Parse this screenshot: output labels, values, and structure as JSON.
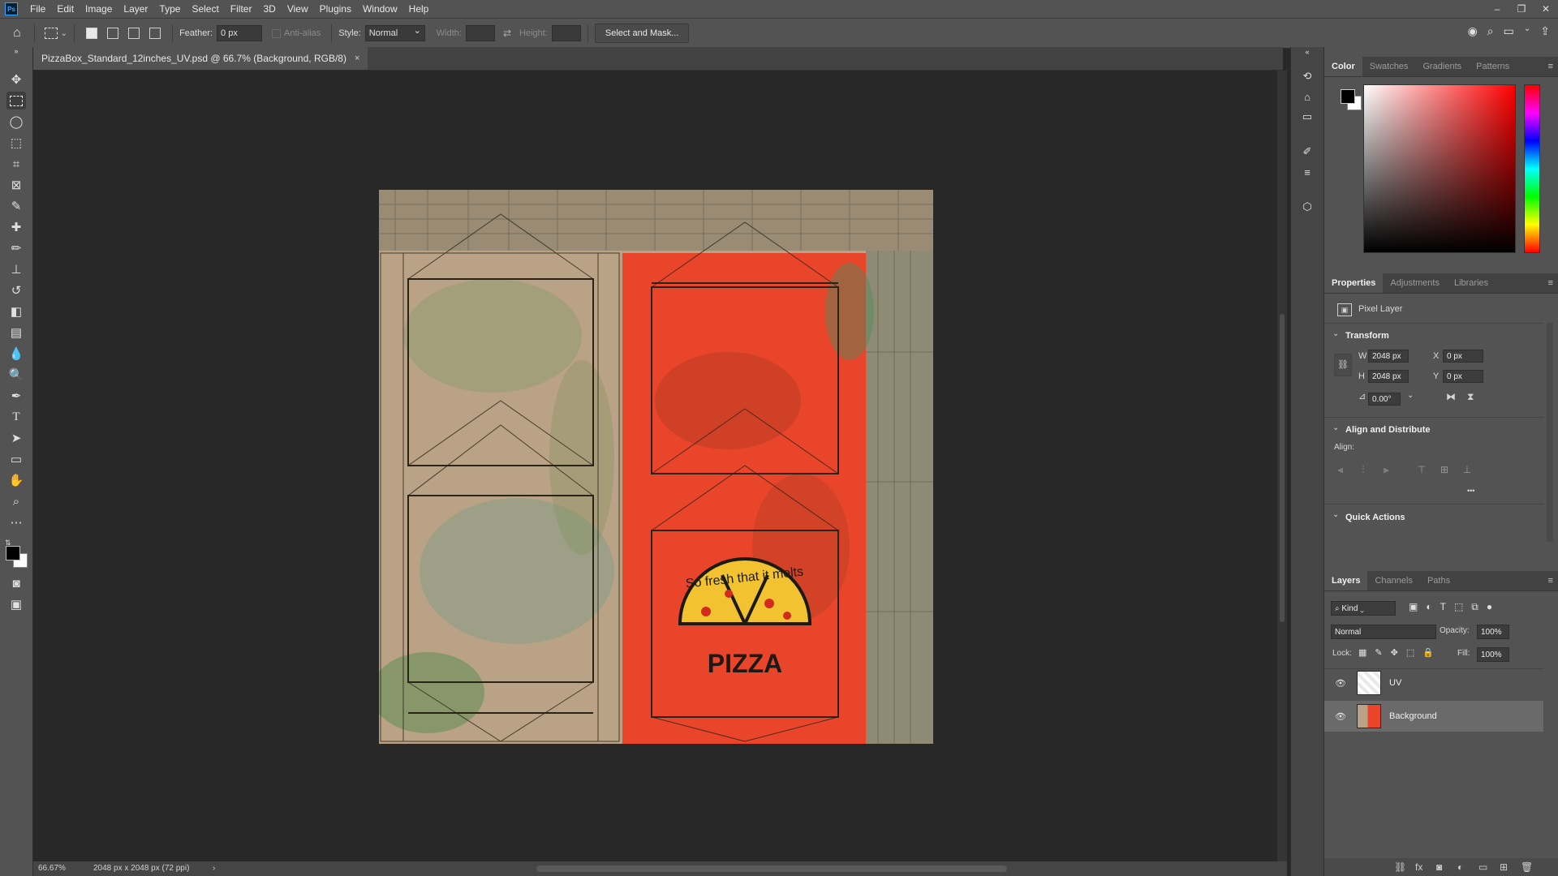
{
  "app": {
    "logo": "Ps",
    "menus": [
      "File",
      "Edit",
      "Image",
      "Layer",
      "Type",
      "Select",
      "Filter",
      "3D",
      "View",
      "Plugins",
      "Window",
      "Help"
    ],
    "window_controls": [
      "–",
      "❐",
      "✕"
    ]
  },
  "options_bar": {
    "feather_label": "Feather:",
    "feather_value": "0 px",
    "anti_alias_label": "Anti-alias",
    "style_label": "Style:",
    "style_value": "Normal",
    "width_label": "Width:",
    "height_label": "Height:",
    "select_mask_label": "Select and Mask..."
  },
  "document": {
    "tab_title": "PizzaBox_Standard_12inches_UV.psd @ 66.7% (Background, RGB/8)",
    "close_glyph": "×",
    "artwork_slogan": "So fresh that it melts",
    "artwork_word": "PIZZA"
  },
  "status": {
    "zoom": "66.67%",
    "dimensions": "2048 px x 2048 px (72 ppi)",
    "arrow": "›"
  },
  "color_panel": {
    "tabs": [
      "Color",
      "Swatches",
      "Gradients",
      "Patterns"
    ],
    "active_tab": "Color",
    "foreground": "#000000",
    "background": "#ffffff",
    "hue_base": "#ff0000"
  },
  "properties_panel": {
    "tabs": [
      "Properties",
      "Adjustments",
      "Libraries"
    ],
    "layer_type": "Pixel Layer",
    "transform_title": "Transform",
    "w_label": "W",
    "w_value": "2048 px",
    "h_label": "H",
    "h_value": "2048 px",
    "x_label": "X",
    "x_value": "0 px",
    "y_label": "Y",
    "y_value": "0 px",
    "angle_value": "0.00°",
    "align_title": "Align and Distribute",
    "align_label": "Align:",
    "more_glyph": "•••",
    "quick_actions_title": "Quick Actions"
  },
  "layers_panel": {
    "tabs": [
      "Layers",
      "Channels",
      "Paths"
    ],
    "kind_filter": "Kind",
    "blend_mode": "Normal",
    "opacity_label": "Opacity:",
    "opacity_value": "100%",
    "lock_label": "Lock:",
    "fill_label": "Fill:",
    "fill_value": "100%",
    "layers": [
      {
        "name": "UV",
        "visible": true,
        "selected": false
      },
      {
        "name": "Background",
        "visible": true,
        "selected": true
      }
    ]
  },
  "colors": {
    "ui_bg": "#535353",
    "canvas_bg": "#282828",
    "box_red": "#e8452a",
    "kraft": "#b9a285"
  }
}
